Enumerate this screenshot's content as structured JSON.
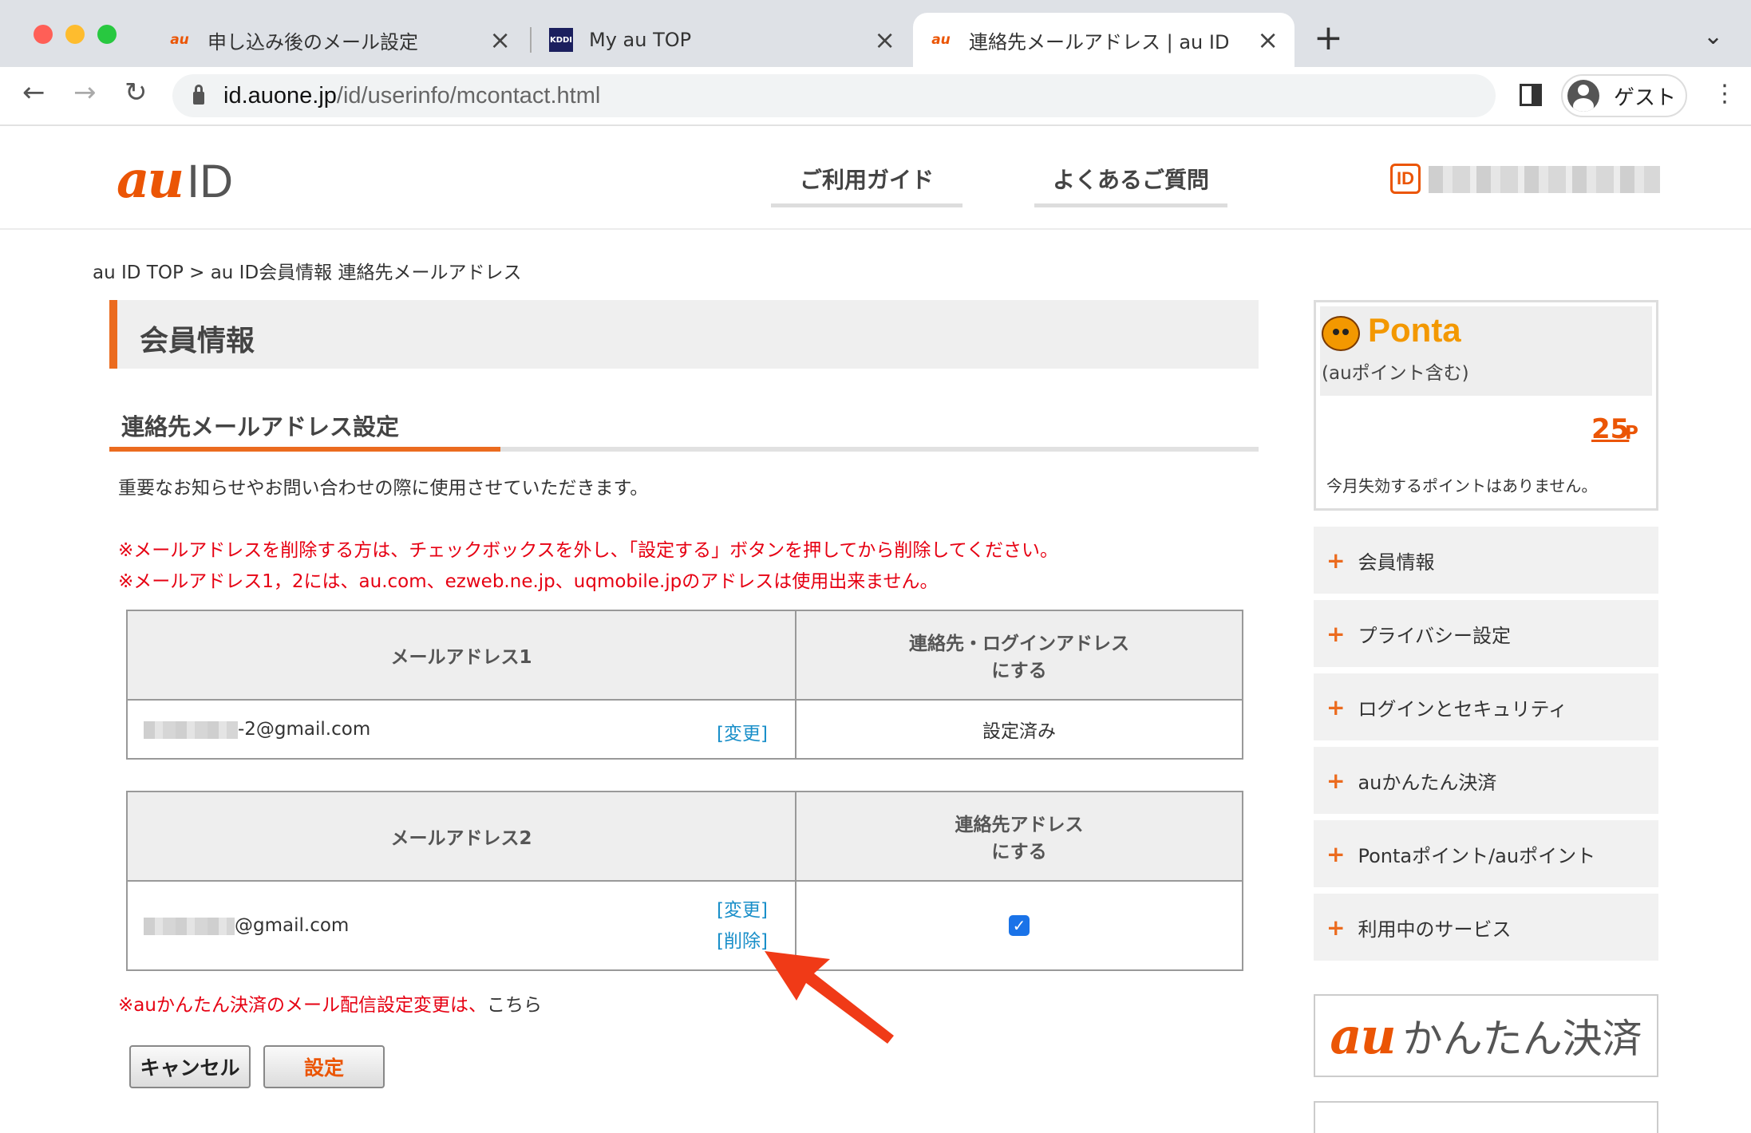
{
  "browser": {
    "tabs": [
      {
        "favicon": "au",
        "title": "申し込み後のメール設定"
      },
      {
        "favicon": "KDDI",
        "title": "My au TOP"
      },
      {
        "favicon": "au",
        "title": "連絡先メールアドレス | au ID"
      }
    ],
    "url_host": "id.auone.jp",
    "url_path": "/id/userinfo/mcontact.html",
    "profile_label": "ゲスト"
  },
  "header": {
    "logo_au": "au",
    "logo_id": "ID",
    "nav": [
      "ご利用ガイド",
      "よくあるご質問"
    ],
    "id_badge": "ID"
  },
  "breadcrumb": "au ID TOP > au ID会員情報  連絡先メールアドレス",
  "page_title": "会員情報",
  "section_title": "連絡先メールアドレス設定",
  "description": "重要なお知らせやお問い合わせの際に使用させていただきます。",
  "notes": [
    "※メールアドレスを削除する方は、チェックボックスを外し、「設定する」ボタンを押してから削除してください。",
    "※メールアドレス1，2には、au.com、ezweb.ne.jp、uqmobile.jpのアドレスは使用出来ません。"
  ],
  "table1": {
    "col1_header": "メールアドレス1",
    "col2_header_line1": "連絡先・ログインアドレス",
    "col2_header_line2": "にする",
    "address_suffix": "-2@gmail.com",
    "change_link": "[変更]",
    "status": "設定済み"
  },
  "table2": {
    "col1_header": "メールアドレス2",
    "col2_header_line1": "連絡先アドレス",
    "col2_header_line2": "にする",
    "address_suffix": "@gmail.com",
    "change_link": "[変更]",
    "delete_link": "[削除]",
    "checked": true
  },
  "payment_note_prefix": "※auかんたん決済のメール配信設定変更は、",
  "payment_note_link": "こちら",
  "buttons": {
    "cancel": "キャンセル",
    "submit": "設定"
  },
  "ponta": {
    "brand": "Ponta",
    "subtitle": "(auポイント含む)",
    "points": "25",
    "unit": "P",
    "expire_text": "今月失効するポイントはありません。"
  },
  "sidebar": {
    "items": [
      {
        "label": "会員情報"
      },
      {
        "label": "プライバシー設定"
      },
      {
        "label": "ログインとセキュリティ"
      },
      {
        "label": "auかんたん決済"
      },
      {
        "label": "Pontaポイント/auポイント"
      },
      {
        "label": "利用中のサービス"
      }
    ]
  },
  "kantan_banner": {
    "au": "au",
    "text": "かんたん決済"
  },
  "colors": {
    "brand_orange": "#eb5505",
    "link_blue": "#1a8fc9",
    "note_red": "#e60012",
    "arrow_red": "#f03a17"
  }
}
